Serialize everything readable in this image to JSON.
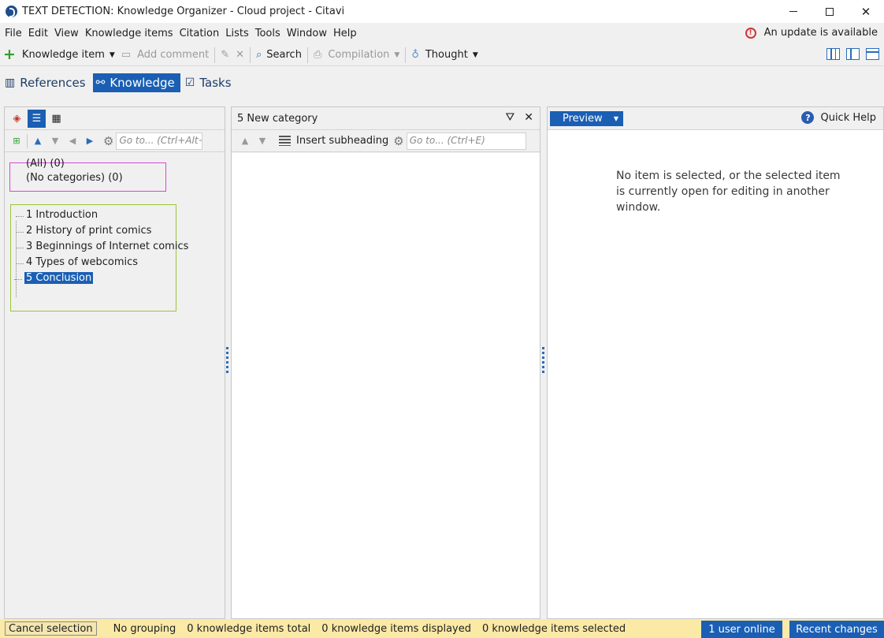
{
  "window": {
    "title": "TEXT DETECTION: Knowledge Organizer - Cloud project - Citavi",
    "minimize": "—",
    "maximize": "□",
    "close": "✕"
  },
  "menu": {
    "items": [
      "File",
      "Edit",
      "View",
      "Knowledge items",
      "Citation",
      "Lists",
      "Tools",
      "Window",
      "Help"
    ],
    "update_notice": "An update is available"
  },
  "toolbar": {
    "knowledge_item": "Knowledge item",
    "add_comment": "Add comment",
    "search": "Search",
    "compilation": "Compilation",
    "thought": "Thought"
  },
  "tabs": [
    {
      "label": "References",
      "active": false
    },
    {
      "label": "Knowledge",
      "active": true
    },
    {
      "label": "Tasks",
      "active": false
    }
  ],
  "left_panel": {
    "goto_placeholder": "Go to... (Ctrl+Alt+",
    "categories": [
      "(All) (0)",
      "(No categories) (0)"
    ],
    "outline": [
      {
        "label": "1 Introduction",
        "selected": false
      },
      {
        "label": "2 History of print comics",
        "selected": false
      },
      {
        "label": "3 Beginnings of Internet comics",
        "selected": false
      },
      {
        "label": "4 Types of webcomics",
        "selected": false
      },
      {
        "label": "5 Conclusion",
        "selected": true
      }
    ]
  },
  "middle_panel": {
    "title": "5 New category",
    "insert_subheading": "Insert subheading",
    "goto_placeholder": "Go to... (Ctrl+E)"
  },
  "right_panel": {
    "preview_label": "Preview",
    "quick_help": "Quick Help",
    "message": "No item is selected, or the selected item is currently open for editing in another window."
  },
  "statusbar": {
    "cancel_selection": "Cancel selection",
    "grouping": "No grouping",
    "total": "0 knowledge items total",
    "displayed": "0 knowledge items displayed",
    "selected": "0 knowledge items selected",
    "users_online": "1 user online",
    "recent_changes": "Recent changes"
  },
  "colors": {
    "accent": "#1a5fb4",
    "status_bar": "#fbe9a6",
    "category_box": "#d44ad4",
    "outline_box": "#9bc53d"
  }
}
